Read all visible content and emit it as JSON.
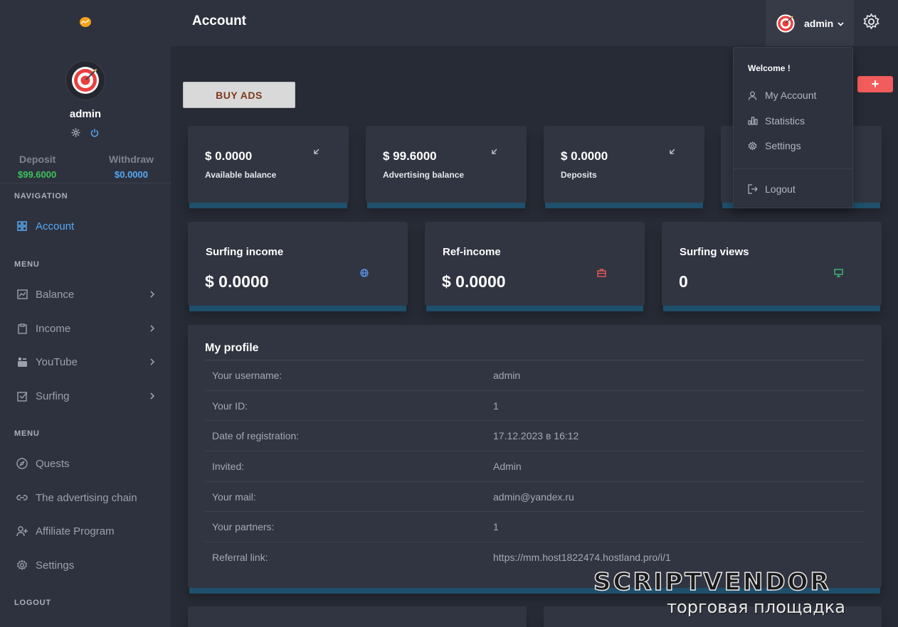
{
  "sidebar": {
    "username": "admin",
    "deposit_label": "Deposit",
    "deposit_value": "$99.6000",
    "withdraw_label": "Withdraw",
    "withdraw_value": "$0.0000",
    "nav_heading": "NAVIGATION",
    "account_label": "Account",
    "menu_heading_1": "MENU",
    "menu1": [
      {
        "label": "Balance",
        "icon": "chart-icon"
      },
      {
        "label": "Income",
        "icon": "clipboard-icon"
      },
      {
        "label": "YouTube",
        "icon": "youtube-icon"
      },
      {
        "label": "Surfing",
        "icon": "checkbox-icon"
      }
    ],
    "menu_heading_2": "MENU",
    "menu2": [
      {
        "label": "Quests",
        "icon": "compass-icon"
      },
      {
        "label": "The advertising chain",
        "icon": "link-icon"
      },
      {
        "label": "Affiliate Program",
        "icon": "user-plus-icon"
      },
      {
        "label": "Settings",
        "icon": "gear-icon"
      }
    ],
    "logout_heading": "LOGOUT"
  },
  "topbar": {
    "title": "Account",
    "user_name": "admin"
  },
  "actions": {
    "buy_ads": "BUY ADS",
    "plus": "+"
  },
  "balances": [
    {
      "amount": "$ 0.0000",
      "label": "Available balance"
    },
    {
      "amount": "$ 99.6000",
      "label": "Advertising balance"
    },
    {
      "amount": "$ 0.0000",
      "label": "Deposits"
    }
  ],
  "stats": [
    {
      "label": "Surfing income",
      "value": "$ 0.0000",
      "icon": "globe-icon",
      "color": "#5b9cf0"
    },
    {
      "label": "Ref-income",
      "value": "$ 0.0000",
      "icon": "briefcase-icon",
      "color": "#f25c5c"
    },
    {
      "label": "Surfing views",
      "value": "0",
      "icon": "monitor-icon",
      "color": "#3cc47c"
    }
  ],
  "profile": {
    "title": "My profile",
    "rows": [
      {
        "key": "Your username:",
        "value": "admin"
      },
      {
        "key": "Your ID:",
        "value": "1"
      },
      {
        "key": "Date of registration:",
        "value": "17.12.2023 в 16:12"
      },
      {
        "key": "Invited:",
        "value": "Admin"
      },
      {
        "key": "Your mail:",
        "value": "admin@yandex.ru"
      },
      {
        "key": "Your partners:",
        "value": "1"
      },
      {
        "key": "Referral link:",
        "value": "https://mm.host1822474.hostland.pro/i/1"
      }
    ]
  },
  "dropdown": {
    "welcome": "Welcome !",
    "items": [
      {
        "label": "My Account",
        "icon": "user-icon"
      },
      {
        "label": "Statistics",
        "icon": "bar-chart-icon"
      },
      {
        "label": "Settings",
        "icon": "gear-icon"
      },
      {
        "label": "Logout",
        "icon": "logout-icon"
      }
    ]
  },
  "colors": {
    "deposit": "#3cc45a",
    "withdraw": "#56a9f5",
    "accent_red": "#f25c5c"
  },
  "watermark": {
    "main": "SCRIPTVENDOR",
    "sub": "торговая площадка"
  }
}
